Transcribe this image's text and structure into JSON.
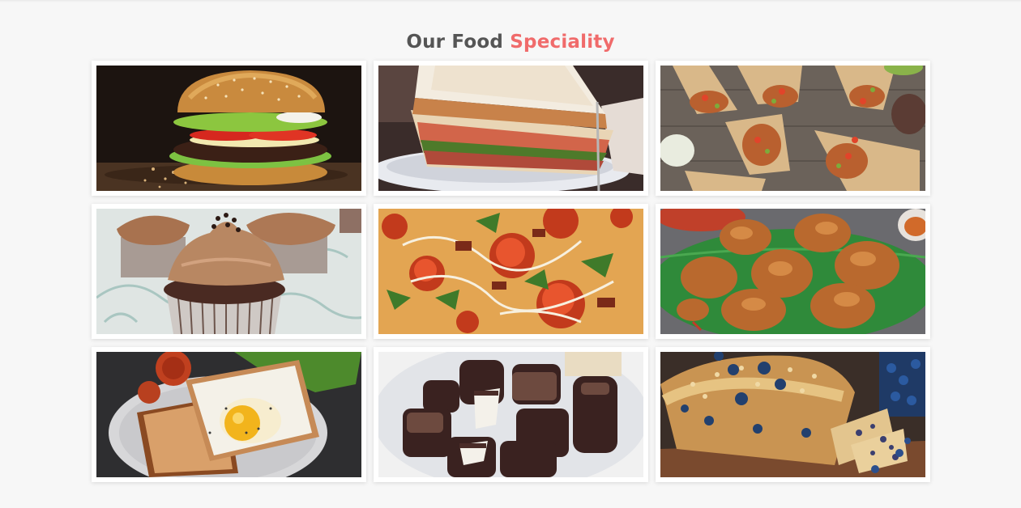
{
  "section": {
    "title_prefix": "Our Food",
    "title_accent": "Speciality",
    "accent_color": "#f06b6b"
  },
  "gallery": [
    {
      "icon": "burger-photo"
    },
    {
      "icon": "sandwich-photo"
    },
    {
      "icon": "wraps-photo"
    },
    {
      "icon": "cupcake-photo"
    },
    {
      "icon": "pizza-photo"
    },
    {
      "icon": "fried-chicken-photo"
    },
    {
      "icon": "egg-toast-photo"
    },
    {
      "icon": "chocolates-photo"
    },
    {
      "icon": "blueberry-bread-photo"
    }
  ]
}
